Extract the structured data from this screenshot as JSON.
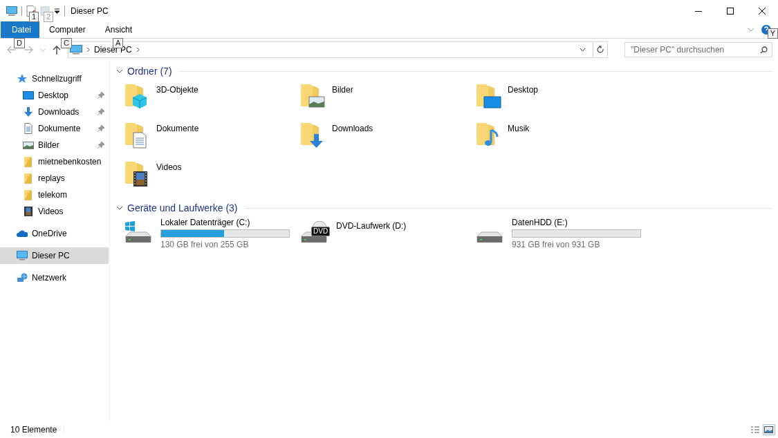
{
  "window": {
    "title": "Dieser PC",
    "keytips": [
      "1",
      "2"
    ]
  },
  "ribbon": {
    "tabs": [
      {
        "label": "Datei",
        "kind": "file",
        "selected": false,
        "keytip": "D"
      },
      {
        "label": "Computer",
        "kind": "tab",
        "selected": false,
        "keytip": "C"
      },
      {
        "label": "Ansicht",
        "kind": "tab",
        "selected": false,
        "keytip": "A"
      }
    ],
    "help_keytip": "Y"
  },
  "address_bar": {
    "crumbs": [
      "Dieser PC"
    ]
  },
  "search": {
    "placeholder": "\"Dieser PC\" durchsuchen"
  },
  "sidebar": {
    "items": [
      {
        "label": "Schnellzugriff",
        "kind": "star",
        "selected": false,
        "children": [
          {
            "label": "Desktop",
            "kind": "desktop",
            "selected": false,
            "pinned": true
          },
          {
            "label": "Downloads",
            "kind": "downloads",
            "selected": false,
            "pinned": true
          },
          {
            "label": "Dokumente",
            "kind": "documents",
            "selected": false,
            "pinned": true
          },
          {
            "label": "Bilder",
            "kind": "pictures",
            "selected": false,
            "pinned": true
          },
          {
            "label": "mietnebenkosten",
            "kind": "folder",
            "selected": false,
            "pinned": false
          },
          {
            "label": "replays",
            "kind": "folder",
            "selected": false,
            "pinned": false
          },
          {
            "label": "telekom",
            "kind": "folder",
            "selected": false,
            "pinned": false
          },
          {
            "label": "Videos",
            "kind": "videos",
            "selected": false,
            "pinned": false
          }
        ]
      },
      {
        "label": "OneDrive",
        "kind": "cloud",
        "selected": false
      },
      {
        "label": "Dieser PC",
        "kind": "pc",
        "selected": true
      },
      {
        "label": "Netzwerk",
        "kind": "network",
        "selected": false
      }
    ]
  },
  "sections": [
    {
      "title": "Ordner (7)",
      "expanded": true,
      "kind": "folders",
      "items": [
        {
          "label": "3D-Objekte",
          "kind": "objects"
        },
        {
          "label": "Bilder",
          "kind": "pictures"
        },
        {
          "label": "Desktop",
          "kind": "desktop"
        },
        {
          "label": "Dokumente",
          "kind": "documents"
        },
        {
          "label": "Downloads",
          "kind": "downloads"
        },
        {
          "label": "Musik",
          "kind": "music"
        },
        {
          "label": "Videos",
          "kind": "videos"
        }
      ]
    },
    {
      "title": "Geräte und Laufwerke (3)",
      "expanded": true,
      "kind": "drives",
      "items": [
        {
          "label": "Lokaler Datenträger (C:)",
          "kind": "windows",
          "level": 0.49,
          "free": "130 GB frei von 255 GB"
        },
        {
          "label": "DVD-Laufwerk (D:)",
          "kind": "dvd",
          "badge": "DVD"
        },
        {
          "label": "DatenHDD (E:)",
          "kind": "hdd",
          "level": 0.0,
          "free": "931 GB frei von 931 GB"
        }
      ]
    }
  ],
  "status_bar": {
    "count": "10 Elemente",
    "views": [
      {
        "kind": "details",
        "selected": false
      },
      {
        "kind": "large",
        "selected": true
      }
    ]
  }
}
